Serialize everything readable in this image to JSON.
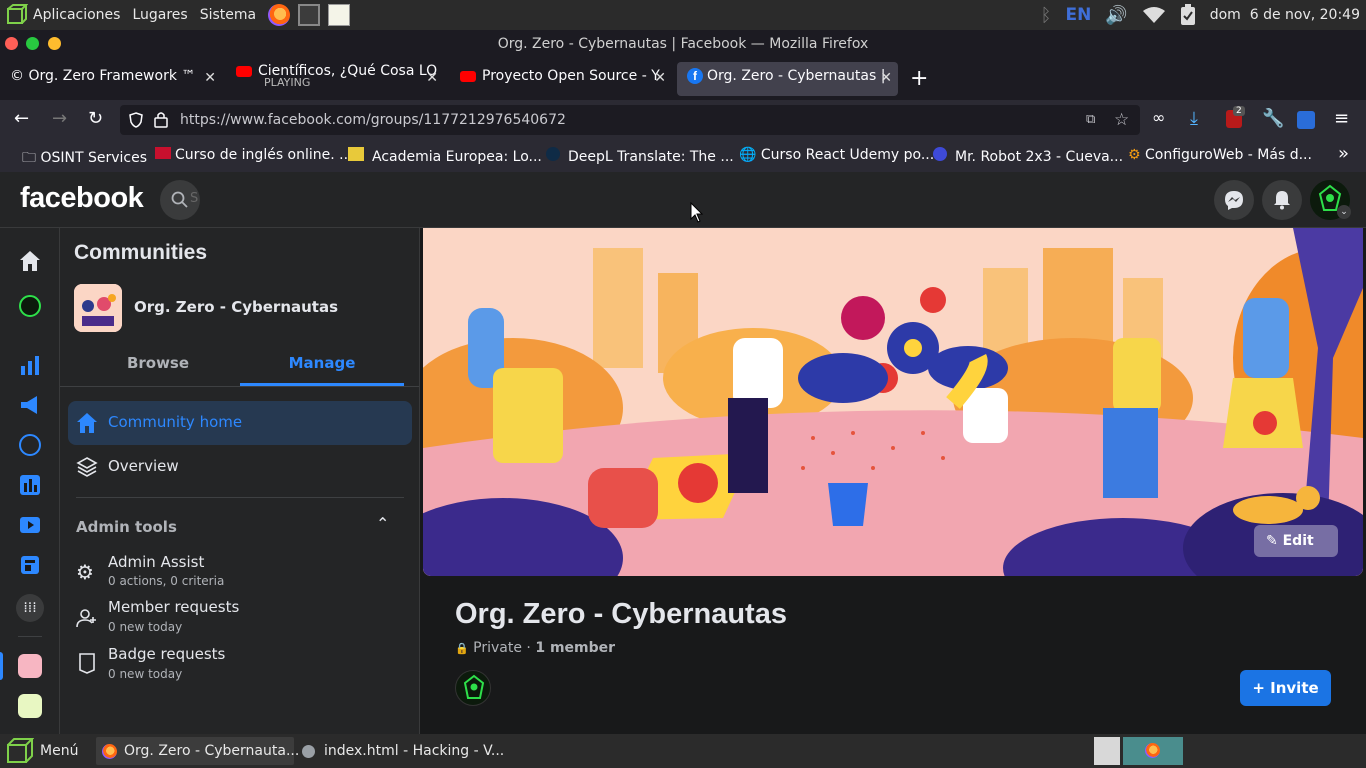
{
  "system_panel": {
    "menus": [
      "Aplicaciones",
      "Lugares",
      "Sistema"
    ],
    "keyboard_layout": "EN",
    "clock": "dom  6 de nov, 20:49"
  },
  "window": {
    "title": "Org. Zero - Cybernautas | Facebook — Mozilla Firefox"
  },
  "tabs": [
    {
      "label": "© Org. Zero Framework ™"
    },
    {
      "label": "Científicos, ¿Qué Cosa LO",
      "sublabel": "PLAYING"
    },
    {
      "label": "Proyecto Open Source - Y"
    },
    {
      "label": "Org. Zero - Cybernautas |"
    }
  ],
  "url": "https://www.facebook.com/groups/1177212976540672",
  "extension_badge": "2",
  "bookmarks": [
    "OSINT Services",
    "Curso de inglés online. ...",
    "Academia Europea: Lo...",
    "DeepL Translate: The ...",
    "Curso React Udemy po...",
    "Mr. Robot 2x3 - Cueva...",
    "ConfiguroWeb - Más d..."
  ],
  "facebook": {
    "logo": "facebook",
    "search_placeholder": "S"
  },
  "sidebar": {
    "heading": "Communities",
    "group_name": "Org. Zero - Cybernautas",
    "tabs": {
      "browse": "Browse",
      "manage": "Manage"
    },
    "nav": {
      "community_home": "Community home",
      "overview": "Overview"
    },
    "admin_tools_label": "Admin tools",
    "admin_items": [
      {
        "title": "Admin Assist",
        "sub": "0 actions, 0 criteria"
      },
      {
        "title": "Member requests",
        "sub": "0 new today"
      },
      {
        "title": "Badge requests",
        "sub": "0 new today"
      }
    ]
  },
  "group": {
    "name": "Org. Zero - Cybernautas",
    "privacy": "Private",
    "members": "1 member",
    "edit_label": "Edit",
    "invite_label": "Invite"
  },
  "taskbar": {
    "menu_label": "Menú",
    "items": [
      "Org. Zero - Cybernauta...",
      "index.html - Hacking - V..."
    ]
  },
  "colors": {
    "fb_blue": "#2d88ff",
    "active_nav_bg": "#263951",
    "invite_bg": "#1b74e4"
  }
}
